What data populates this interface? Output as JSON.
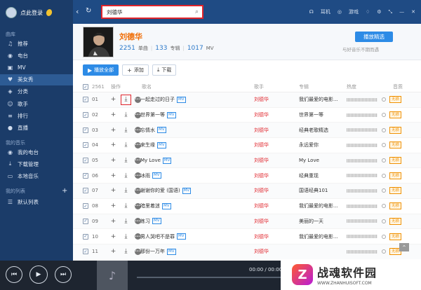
{
  "sidebar": {
    "login": "点此登录",
    "section_library": "曲库",
    "library_items": [
      {
        "label": "推荐",
        "icon": "music-note-icon"
      },
      {
        "label": "电台",
        "icon": "radio-icon"
      },
      {
        "label": "MV",
        "icon": "video-icon"
      },
      {
        "label": "美女秀",
        "icon": "heart-icon"
      },
      {
        "label": "分类",
        "icon": "tag-icon"
      },
      {
        "label": "歌手",
        "icon": "user-icon"
      },
      {
        "label": "排行",
        "icon": "chart-icon"
      },
      {
        "label": "直播",
        "icon": "mic-icon"
      }
    ],
    "section_my_music": "我的音乐",
    "my_items": [
      {
        "label": "我的电台",
        "icon": "radio-icon"
      },
      {
        "label": "下载管理",
        "icon": "download-icon"
      },
      {
        "label": "本地音乐",
        "icon": "computer-icon"
      }
    ],
    "section_my_list": "我的列表",
    "list_items": [
      {
        "label": "默认列表",
        "icon": "list-icon"
      }
    ]
  },
  "topbar": {
    "search_value": "刘德华",
    "earphone_label": "耳机",
    "game_label": "游戏"
  },
  "artist": {
    "name": "刘德华",
    "songs_count": "2251",
    "songs_label": "单曲",
    "albums_count": "133",
    "albums_label": "专辑",
    "mv_count": "1017",
    "mv_label": "MV",
    "play_best": "播放精选",
    "fans_note": "与好音乐不期而遇"
  },
  "toolbar": {
    "play_all": "播放全部",
    "add": "添加",
    "download": "下载"
  },
  "table": {
    "count": "2561",
    "col_ops": "操作",
    "col_title": "歌名",
    "col_artist": "歌手",
    "col_album": "专辑",
    "col_hot": "热度",
    "col_quality": "音质",
    "rows": [
      {
        "num": "01",
        "title": "一起走过的日子",
        "mv": "MV",
        "artist": "刘德华",
        "album": "我们最爱的电影...",
        "quality": "无损"
      },
      {
        "num": "02",
        "title": "世界第一等",
        "mv": "MV",
        "artist": "刘德华",
        "album": "世界第一等",
        "quality": "无损"
      },
      {
        "num": "03",
        "title": "忘情水",
        "mv": "MV",
        "artist": "刘德华",
        "album": "经典老歌精选",
        "quality": "无损"
      },
      {
        "num": "04",
        "title": "来生缘",
        "mv": "MV",
        "artist": "刘德华",
        "album": "永远爱你",
        "quality": "无损"
      },
      {
        "num": "05",
        "title": "My Love",
        "mv": "MV",
        "artist": "刘德华",
        "album": "My Love",
        "quality": "无损"
      },
      {
        "num": "06",
        "title": "冰雨",
        "mv": "MV",
        "artist": "刘德华",
        "album": "经典重现",
        "quality": "无损"
      },
      {
        "num": "07",
        "title": "谢谢你的爱 (国语)",
        "mv": "MV",
        "artist": "刘德华",
        "album": "国语经典101",
        "quality": "无损"
      },
      {
        "num": "08",
        "title": "暗里着迷",
        "mv": "MV",
        "artist": "刘德华",
        "album": "我们最爱的电影...",
        "quality": "无损"
      },
      {
        "num": "09",
        "title": "练习",
        "mv": "MV",
        "artist": "刘德华",
        "album": "美丽的一天",
        "quality": "无损"
      },
      {
        "num": "10",
        "title": "男人哭吧不是罪",
        "mv": "MV",
        "artist": "刘德华",
        "album": "我们最爱的电影...",
        "quality": "无损"
      },
      {
        "num": "11",
        "title": "那份一万年",
        "mv": "MV",
        "artist": "刘德华",
        "album": "",
        "quality": "无损"
      }
    ]
  },
  "player": {
    "time": "00:00 / 00:00"
  },
  "watermark": {
    "logo": "Z",
    "text": "战魂软件园",
    "url": "WWW.ZHANHUISOFT.COM"
  }
}
